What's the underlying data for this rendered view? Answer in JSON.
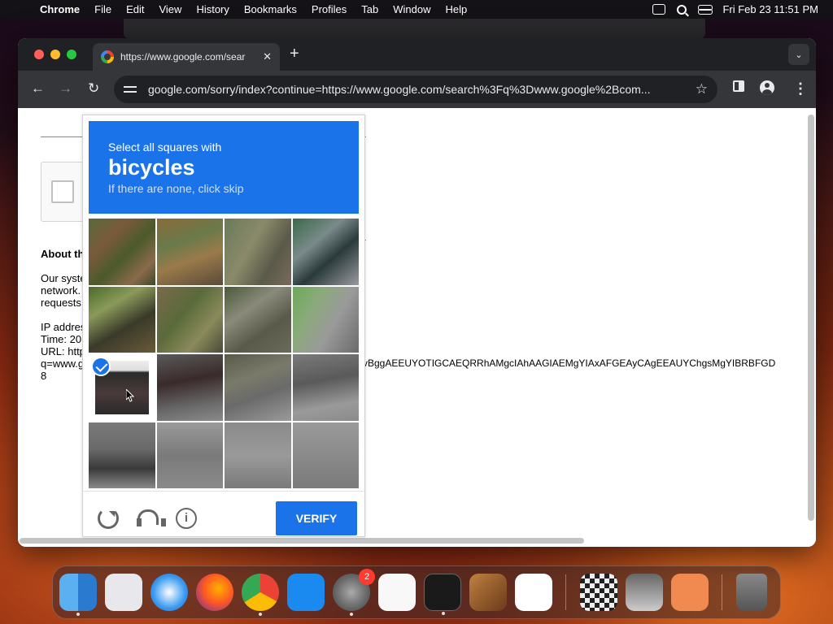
{
  "menubar": {
    "app": "Chrome",
    "items": [
      "File",
      "Edit",
      "View",
      "History",
      "Bookmarks",
      "Profiles",
      "Tab",
      "Window",
      "Help"
    ],
    "clock": "Fri Feb 23  11:51 PM"
  },
  "browser": {
    "tab_title": "https://www.google.com/sear",
    "url_host": "google.com",
    "url_rest": "/sorry/index?continue=https://www.google.com/search%3Fq%3Dwww.google%2Bcom..."
  },
  "page": {
    "about_heading": "About th",
    "paragraph1": [
      "Our syste",
      "network.",
      "requests"
    ],
    "paragraph2": [
      "IP addres",
      "Time: 20",
      "URL: http",
      "q=www.g",
      "8"
    ],
    "long_url_tail": "vBggAEEUYOTIGCAEQRRhAMgcIAhAAGIAEMgYIAxAFGEAyCAgEEAUYChgsMgYIBRBFGD"
  },
  "captcha": {
    "instruction": "Select all squares with",
    "target": "bicycles",
    "hint": "If there are none, click skip",
    "selected_tiles": [
      8
    ],
    "verify_label": "VERIFY"
  },
  "dock": {
    "apps": [
      "Finder",
      "Launchpad",
      "Safari",
      "Firefox",
      "Chrome",
      "App Store",
      "System Settings",
      "TextEdit",
      "Terminal",
      "GarageBand",
      "VS Code",
      "Chess",
      "Image Capture",
      "Screen Sharing",
      "Trash"
    ],
    "settings_badge": "2"
  },
  "colors": {
    "captcha_blue": "#1a73e8",
    "chrome_dark": "#35363a"
  }
}
